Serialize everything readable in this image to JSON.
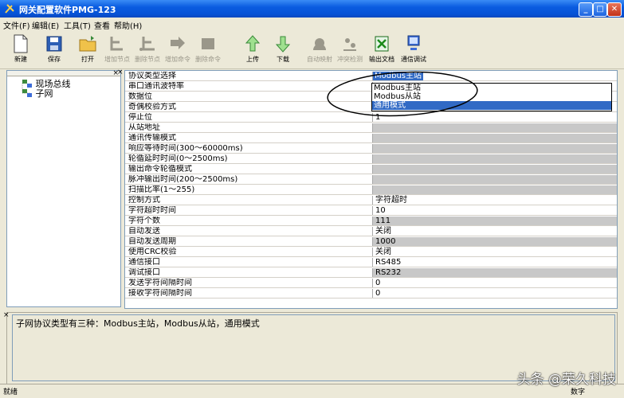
{
  "window": {
    "title": "网关配置软件PMG-123",
    "min": "_",
    "max": "□",
    "close": "✕"
  },
  "menu": [
    "文件(F)",
    "编辑(E)",
    "工具(T)",
    "查看",
    "帮助(H)"
  ],
  "toolbar": [
    {
      "label": "新建",
      "icon": "new-file-icon",
      "enabled": true
    },
    {
      "label": "保存",
      "icon": "save-icon",
      "enabled": true
    },
    {
      "label": "打开",
      "icon": "open-folder-icon",
      "enabled": true
    },
    {
      "label": "增加节点",
      "icon": "add-node-icon",
      "enabled": false
    },
    {
      "label": "删除节点",
      "icon": "delete-node-icon",
      "enabled": false
    },
    {
      "label": "增加命令",
      "icon": "add-command-icon",
      "enabled": false
    },
    {
      "label": "删除命令",
      "icon": "delete-command-icon",
      "enabled": false
    },
    {
      "label": "上传",
      "icon": "upload-icon",
      "enabled": true
    },
    {
      "label": "下载",
      "icon": "download-icon",
      "enabled": true
    },
    {
      "label": "自动映射",
      "icon": "auto-map-icon",
      "enabled": false
    },
    {
      "label": "冲突检测",
      "icon": "conflict-check-icon",
      "enabled": false
    },
    {
      "label": "输出文档",
      "icon": "export-doc-icon",
      "enabled": true
    },
    {
      "label": "通信调试",
      "icon": "comm-debug-icon",
      "enabled": true
    }
  ],
  "tree": {
    "close": "×",
    "root": "现场总线",
    "child": "子网"
  },
  "grid": {
    "close": "×",
    "rows": [
      {
        "key": "协议类型选择",
        "value": "Modbus主站",
        "style": "sel"
      },
      {
        "key": "串口通讯波特率",
        "value": "",
        "style": ""
      },
      {
        "key": "数据位",
        "value": "",
        "style": ""
      },
      {
        "key": "奇偶校验方式",
        "value": "",
        "style": ""
      },
      {
        "key": "停止位",
        "value": "1",
        "style": ""
      },
      {
        "key": "从站地址",
        "value": "",
        "style": "gray"
      },
      {
        "key": "通讯传输模式",
        "value": "",
        "style": "gray"
      },
      {
        "key": "响应等待时间(300～60000ms)",
        "value": "",
        "style": "gray"
      },
      {
        "key": "轮循延时时间(0～2500ms)",
        "value": "",
        "style": "gray"
      },
      {
        "key": "输出命令轮循模式",
        "value": "",
        "style": "gray"
      },
      {
        "key": "脉冲输出时间(200～2500ms)",
        "value": "",
        "style": "gray"
      },
      {
        "key": "扫描比率(1～255)",
        "value": "",
        "style": "gray"
      },
      {
        "key": "控制方式",
        "value": "字符超时",
        "style": ""
      },
      {
        "key": "字符超时时间",
        "value": "10",
        "style": ""
      },
      {
        "key": "字符个数",
        "value": "111",
        "style": "gray"
      },
      {
        "key": "自动发送",
        "value": "关闭",
        "style": ""
      },
      {
        "key": "自动发送周期",
        "value": "1000",
        "style": "gray"
      },
      {
        "key": "使用CRC校验",
        "value": "关闭",
        "style": ""
      },
      {
        "key": "通信接口",
        "value": "RS485",
        "style": ""
      },
      {
        "key": "调试接口",
        "value": "RS232",
        "style": "gray"
      },
      {
        "key": "发送字符间隔时间",
        "value": "0",
        "style": ""
      },
      {
        "key": "接收字符间隔时间",
        "value": "0",
        "style": ""
      }
    ]
  },
  "dropdown": {
    "options": [
      "Modbus主站",
      "Modbus从站",
      "通用模式"
    ],
    "highlighted": 2
  },
  "description": {
    "close": "×",
    "text": "子网协议类型有三种：Modbus主站，Modbus从站，通用模式"
  },
  "status": {
    "left": "就绪",
    "right": "数字"
  },
  "watermark": "头条 @荣久科技"
}
